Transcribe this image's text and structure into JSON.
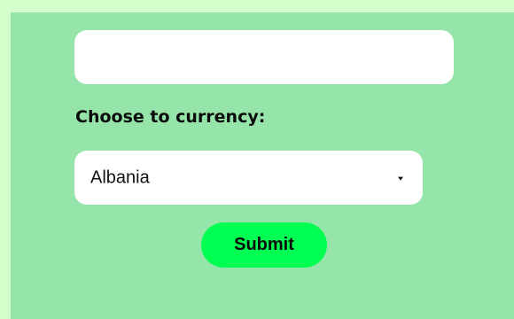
{
  "form": {
    "amount_value": "",
    "amount_placeholder": "",
    "currency_label": "Choose to currency:",
    "currency_selected": "Albania",
    "submit_label": "Submit"
  },
  "colors": {
    "page_background": "#d3fecb",
    "panel_background": "#95e4a9",
    "field_background": "#ffffff",
    "submit_background": "#00ff52"
  },
  "icons": {
    "select_caret": "chevron-down-icon"
  }
}
